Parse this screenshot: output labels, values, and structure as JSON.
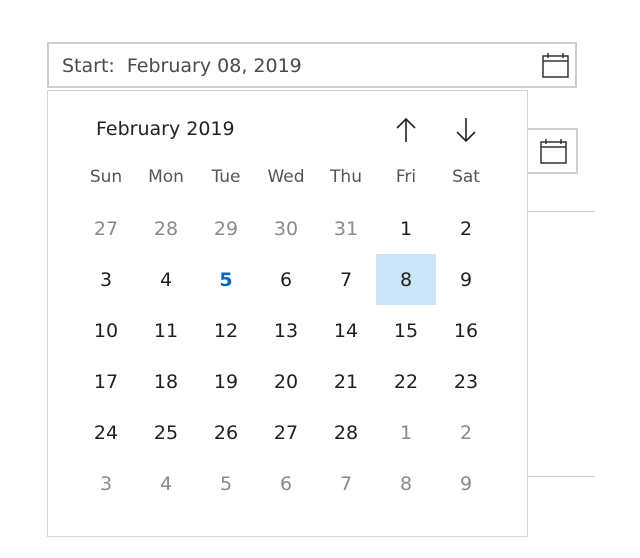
{
  "start_field": {
    "label": "Start:",
    "value": "February 08, 2019",
    "icon": "calendar-icon"
  },
  "end_field": {
    "icon": "calendar-icon"
  },
  "calendar": {
    "month_label": "February 2019",
    "nav_up_icon": "arrow-up-icon",
    "nav_down_icon": "arrow-down-icon",
    "weekdays": [
      "Sun",
      "Mon",
      "Tue",
      "Wed",
      "Thu",
      "Fri",
      "Sat"
    ],
    "weeks": [
      [
        {
          "d": "27",
          "o": true
        },
        {
          "d": "28",
          "o": true
        },
        {
          "d": "29",
          "o": true
        },
        {
          "d": "30",
          "o": true
        },
        {
          "d": "31",
          "o": true
        },
        {
          "d": "1"
        },
        {
          "d": "2"
        }
      ],
      [
        {
          "d": "3"
        },
        {
          "d": "4"
        },
        {
          "d": "5",
          "today": true
        },
        {
          "d": "6"
        },
        {
          "d": "7"
        },
        {
          "d": "8",
          "selected": true
        },
        {
          "d": "9"
        }
      ],
      [
        {
          "d": "10"
        },
        {
          "d": "11"
        },
        {
          "d": "12"
        },
        {
          "d": "13"
        },
        {
          "d": "14"
        },
        {
          "d": "15"
        },
        {
          "d": "16"
        }
      ],
      [
        {
          "d": "17"
        },
        {
          "d": "18"
        },
        {
          "d": "19"
        },
        {
          "d": "20"
        },
        {
          "d": "21"
        },
        {
          "d": "22"
        },
        {
          "d": "23"
        }
      ],
      [
        {
          "d": "24"
        },
        {
          "d": "25"
        },
        {
          "d": "26"
        },
        {
          "d": "27"
        },
        {
          "d": "28"
        },
        {
          "d": "1",
          "o": true
        },
        {
          "d": "2",
          "o": true
        }
      ],
      [
        {
          "d": "3",
          "o": true
        },
        {
          "d": "4",
          "o": true
        },
        {
          "d": "5",
          "o": true
        },
        {
          "d": "6",
          "o": true
        },
        {
          "d": "7",
          "o": true
        },
        {
          "d": "8",
          "o": true
        },
        {
          "d": "9",
          "o": true
        }
      ]
    ]
  },
  "colors": {
    "accent": "#0067c0",
    "selected_bg": "#cce4f7",
    "border": "#cfcfcf"
  }
}
